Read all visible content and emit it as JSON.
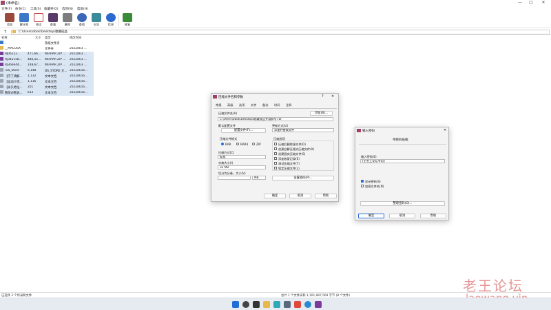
{
  "window": {
    "title": "(未命名)",
    "controls": [
      "—",
      "□",
      "✕"
    ]
  },
  "menu": [
    "文件(F)",
    "命令(C)",
    "工具(S)",
    "收藏夹(O)",
    "选项(N)",
    "帮助(H)"
  ],
  "toolbar": [
    {
      "label": "添加",
      "icon": "add-icon",
      "color": "#9a4a3a"
    },
    {
      "label": "解压到",
      "icon": "extract-to-icon",
      "color": "#3a78c8"
    },
    {
      "label": "测试",
      "icon": "test-icon",
      "color": "#c23a3a"
    },
    {
      "label": "查看",
      "icon": "view-icon",
      "color": "#5a3a6a"
    },
    {
      "label": "删除",
      "icon": "delete-icon",
      "color": "#6a6a6a"
    },
    {
      "label": "查找",
      "icon": "find-icon",
      "color": "#3a68b8"
    },
    {
      "label": "向导",
      "icon": "wizard-icon",
      "color": "#3a8a9a"
    },
    {
      "label": "信息",
      "icon": "info-icon",
      "color": "#2a6ad0"
    },
    {
      "label": "修复",
      "icon": "repair-icon",
      "color": "#3a8a3a"
    }
  ],
  "address": "C:\\Users\\obok\\Desktop\\收藏成品",
  "columns": {
    "name": "名称",
    "size": "大小",
    "type": "类型",
    "modified": "修改时间"
  },
  "files": [
    {
      "name": "..",
      "size": "",
      "type": "系统文件夹",
      "modified": "",
      "icon": "#3a78c8"
    },
    {
      "name": "__MACOSX",
      "size": "",
      "type": "文件夹",
      "modified": "2022/8/3 ...",
      "icon": "#e7b84b"
    },
    {
      "name": "RJ06122...",
      "size": "471,66...",
      "type": "WinRAR ZIP ...",
      "modified": "2022/8/3 ...",
      "icon": "#7a3b9a"
    },
    {
      "name": "RJ345158...",
      "size": "480,55...",
      "type": "WinRAR ZIP ...",
      "modified": "2022/8/3 ...",
      "icon": "#7a3b9a"
    },
    {
      "name": "RJ366644...",
      "size": "148,67...",
      "type": "WinRAR ZIP ...",
      "modified": "2022/8/3 ...",
      "icon": "#7a3b9a"
    },
    {
      "name": ".DS_Store",
      "size": "6,148",
      "type": "DS_STORE 文...",
      "modified": "2022/8/16...",
      "icon": "#9aa4b0"
    },
    {
      "name": "【学了请解...",
      "size": "1,132",
      "type": "文本文档",
      "modified": "2022/8/16...",
      "icon": "#9aa4b0"
    },
    {
      "name": "【运动介绍...",
      "size": "1,116",
      "type": "文本文档",
      "modified": "2022/8/16...",
      "icon": "#9aa4b0"
    },
    {
      "name": "【永久地址...",
      "size": "201",
      "type": "文本文档",
      "modified": "2022/8/16...",
      "icon": "#9aa4b0"
    },
    {
      "name": "看前必看说...",
      "size": "633",
      "type": "文本文档",
      "modified": "2022/8/16...",
      "icon": "#9aa4b0"
    }
  ],
  "status": {
    "left": "已选择 3 个目录和文件",
    "right": "总计 1 个文件夹和 1,101,987,569 字节 (8 个文件)"
  },
  "dialog_archive": {
    "title": "压缩文件名和参数",
    "tabs": [
      "常规",
      "高级",
      "选项",
      "文件",
      "备份",
      "时间",
      "注释"
    ],
    "archive_name_label": "压缩文件名(A)",
    "browse_button": "浏览(B)...",
    "archive_name_value": "C:\\Users\\obok\\Desktop\\收藏成品专用群号.rar",
    "profile_label": "默认配置文件",
    "profile_button": "配置文件(F)...",
    "update_label": "更新方式(U)",
    "update_value": "添加并替换文件",
    "format_label": "压缩文件格式",
    "formats": [
      "RAR",
      "RAR4",
      "ZIP"
    ],
    "options_label": "压缩选项",
    "options": [
      "压缩后删除源文件(D)",
      "创建自解压格式压缩文件(X)",
      "创建固实压缩文件(S)",
      "添加恢复记录(E)",
      "测试压缩文件(T)",
      "锁定压缩文件(L)"
    ],
    "method_label": "压缩方式(C)",
    "method_value": "标准",
    "dict_label": "字典大小(I)",
    "dict_value": "32 MB",
    "split_label": "切分为分卷，大小(V)",
    "split_unit": "MB",
    "password_button": "设置密码(P)...",
    "ok": "确定",
    "cancel": "取消",
    "help": "帮助"
  },
  "dialog_password": {
    "title": "输入密码",
    "heading": "带密码压缩",
    "input_label": "输入密码(E)",
    "input_value": "[主名王论坛专用]",
    "show_password": "显示密码(S)",
    "encrypt_names": "加密文件名(N)",
    "manage_button": "整理密码(O)...",
    "ok": "确定",
    "cancel": "取消",
    "help": "帮助"
  },
  "watermark": {
    "cn": "老王论坛",
    "en": "laowang.vip"
  }
}
